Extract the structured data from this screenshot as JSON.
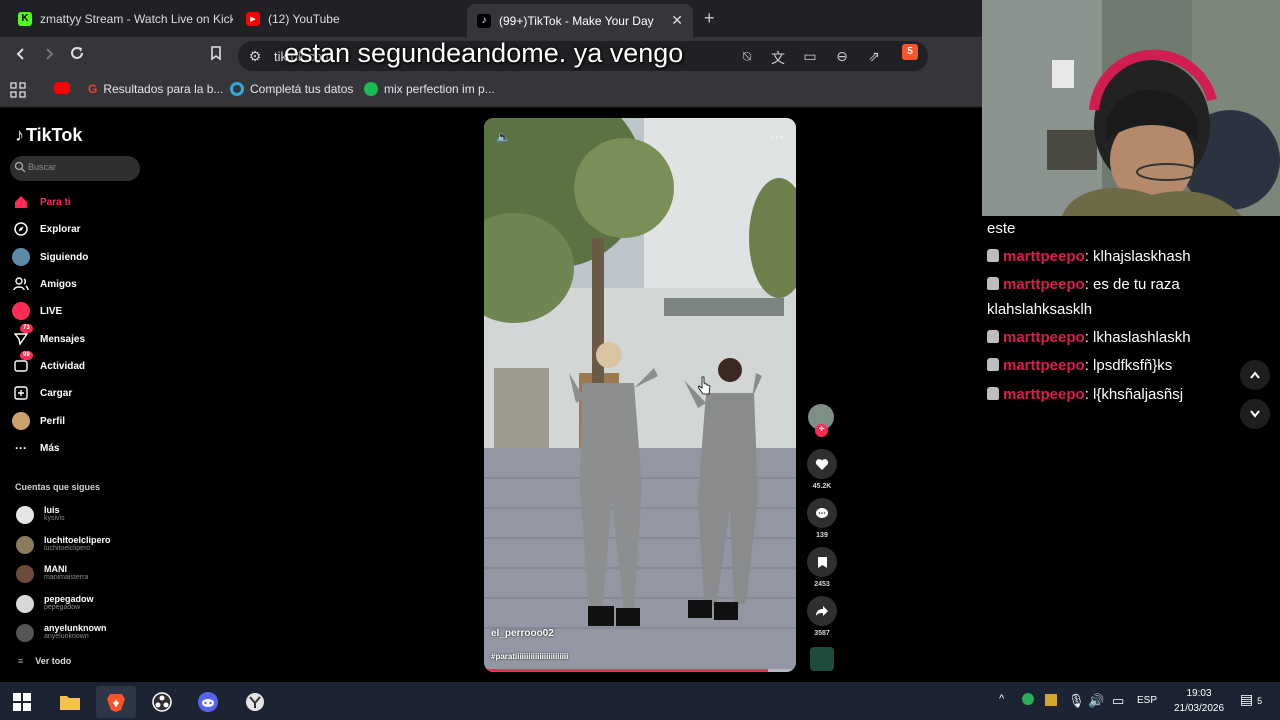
{
  "browser": {
    "tabs": [
      {
        "title": "zmattyy Stream - Watch Live on Kick",
        "icon": "kick-icon"
      },
      {
        "title": "(12) YouTube",
        "icon": "youtube-icon"
      },
      {
        "title": "(99+)TikTok - Make Your Day",
        "icon": "tiktok-icon",
        "active": true
      }
    ],
    "close_tab_glyph": "✕",
    "new_tab_glyph": "+",
    "url": "tiktok.com",
    "extension_badge": "5",
    "bookmarks": [
      {
        "label": "",
        "icon": "youtube-icon"
      },
      {
        "label": "Resultados para la b...",
        "icon": "google-icon"
      },
      {
        "label": "Completá tus datos",
        "icon": "ring-icon"
      },
      {
        "label": "mix perfection im p...",
        "icon": "spotify-icon"
      }
    ]
  },
  "caption": "estan segundeandome. ya vengo",
  "tiktok": {
    "logo": "TikTok",
    "search_placeholder": "Buscar",
    "menu": [
      {
        "label": "Para ti",
        "icon": "home-icon",
        "active": true
      },
      {
        "label": "Explorar",
        "icon": "compass-icon"
      },
      {
        "label": "Siguiendo",
        "icon": "following-avatar-icon"
      },
      {
        "label": "Amigos",
        "icon": "friends-icon"
      },
      {
        "label": "LIVE",
        "icon": "live-icon"
      },
      {
        "label": "Mensajes",
        "icon": "messages-icon",
        "badge": "73"
      },
      {
        "label": "Actividad",
        "icon": "activity-icon",
        "badge": "99"
      },
      {
        "label": "Cargar",
        "icon": "upload-icon"
      },
      {
        "label": "Perfil",
        "icon": "profile-icon"
      },
      {
        "label": "Más",
        "icon": "more-icon"
      }
    ],
    "following_title": "Cuentas que sigues",
    "following": [
      {
        "name": "luis",
        "handle": "kysivis"
      },
      {
        "name": "luchitoelclipero",
        "handle": "luchitoelclipero"
      },
      {
        "name": "MANI",
        "handle": "manimaisterra"
      },
      {
        "name": "pepegadow",
        "handle": "pepegadow"
      },
      {
        "name": "anyelunknown",
        "handle": "anyelunknown"
      }
    ],
    "see_all": "Ver todo",
    "video": {
      "username": "el_perrooo02",
      "hashtag": "#paratiiiiiiiiiiiiiiiiiiiiiiii",
      "progress": 0.91,
      "likes": "45.2K",
      "comments": "139",
      "saves": "2453",
      "shares": "3587"
    }
  },
  "chat": {
    "messages": [
      {
        "user": "",
        "text": "este"
      },
      {
        "user": "marttpeepo",
        "text": ": klhajslaskhash"
      },
      {
        "user": "marttpeepo",
        "text": ": es de tu raza klahslahksasklh"
      },
      {
        "user": "marttpeepo",
        "text": ": lkhaslashlaskh"
      },
      {
        "user": "marttpeepo",
        "text": ": lpsdfksfñ}ks"
      },
      {
        "user": "marttpeepo",
        "text": ": l{khsñaljasñsj"
      }
    ]
  },
  "taskbar": {
    "language": "ESP",
    "time": "19:03",
    "date": "21/03/2026",
    "notifications": "5"
  },
  "colors": {
    "tiktok_accent": "#fe2c55",
    "chat_user": "#d91d4c",
    "taskbar": "#1c2433"
  }
}
